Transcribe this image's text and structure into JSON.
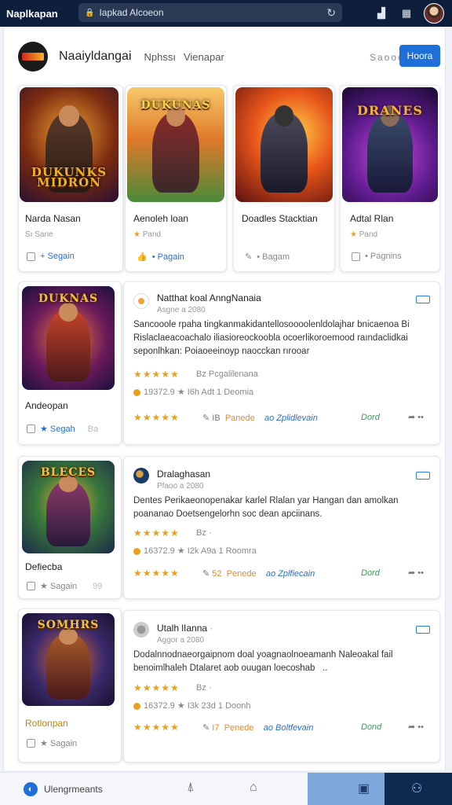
{
  "browser": {
    "app_name": "Naplkapan",
    "url": "Iapkad Alcoeon",
    "colors": {
      "bar": "#0d1f3c"
    }
  },
  "header": {
    "site_title": "Naaiyldangai",
    "nav": [
      "Nphssı",
      "Vienapar"
    ],
    "dots": "Saooo",
    "button": "Hoora",
    "accent": "#1e6fd9"
  },
  "top_games": [
    {
      "art_text": "DUKUNKS\nMIDRON",
      "title": "Narda Nasan",
      "sub": "Sı Sane",
      "action": "Segain",
      "action_icon": "plus-icon"
    },
    {
      "art_text": "DUKUNAS",
      "title": "Aenoleh loan",
      "sub": "Pand",
      "action": "Pagain",
      "action_icon": "thumbs-up-icon"
    },
    {
      "art_text": "",
      "title": "Doadles Stacktian",
      "sub": "",
      "action": "Bagam",
      "action_icon": "edit-icon"
    },
    {
      "art_text": "DRANES",
      "title": "Adtal Rlan",
      "sub": "Pand",
      "action": "Pagnins",
      "action_icon": "plus-icon"
    }
  ],
  "reviews": [
    {
      "game": {
        "art_text": "DUKNAS",
        "title": "Andeopan",
        "action": "Segah",
        "extra": "Ba"
      },
      "reviewer": "Natthat koal AnngNanaia",
      "date": "Asgne a 2080",
      "text": [
        "Sancooole rpaha  tingkanmakidantellosoooolenldolajhar bnicaenoa Bi",
        "Rislaclaeacoachalo iliasioreockoobla ocoerlikoroemood raındaclidkai",
        "seponlhkan: Poiaoeeinoyp naocckan rırooar"
      ],
      "stars1": "★★★★★",
      "meta1": "Bz   Pcgalilenana",
      "rating": "19372.9",
      "meta2": "I6h  Adt 1 Deomia",
      "stars2": "★★★★★",
      "foot_num": "IB",
      "foot_orange": "Panede",
      "foot_blue": "ao Zplidlevain",
      "foot_green": "Dord"
    },
    {
      "game": {
        "art_text": "BLECES",
        "title": "Defiecba",
        "action": "Sagain",
        "extra": "99"
      },
      "reviewer": "Dralaghasan",
      "date": "Pfaoo a 2080",
      "text": [
        "Dentes Perikaeonopenakar karlel Rlalan yar Hangan  dan amolkan",
        "poananao Doetsengelorhn soc dean apciinans."
      ],
      "stars1": "★★★★★",
      "meta1": "Bz  ·",
      "rating": "16372.9",
      "meta2": "I2k  A9a 1 Roomra",
      "stars2": "★★★★★",
      "foot_num": "52",
      "foot_orange": "Penede",
      "foot_blue": "ao Zplfiecain",
      "foot_green": "Dord"
    },
    {
      "game": {
        "art_text": "SOMHRS",
        "title": "Rotlonpan",
        "action": "Sagain",
        "extra": ""
      },
      "reviewer": "Utalh lIanna",
      "date": "Aggor  a 2080",
      "text": [
        "Dodalnnodnaeorgaipnom doal yoagnaolnoeamanh Naleoakal fail",
        "benoimlhaleh Dtalaret aob ouugan loecoshab"
      ],
      "stars1": "★★★★★",
      "meta1": "Bz  ·",
      "rating": "16372.9",
      "meta2": "I3k  23d 1 Doonh",
      "stars2": "★★★★★",
      "foot_num": "I7",
      "foot_orange": "Penede",
      "foot_blue": "ao Boltfevain",
      "foot_green": "Dond"
    }
  ],
  "bottom": {
    "app_label": "Ulengrmeants"
  }
}
